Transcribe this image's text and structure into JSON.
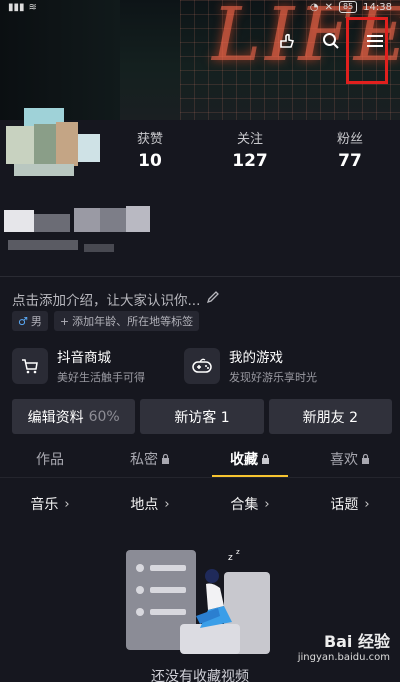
{
  "status": {
    "left_icons": [
      "signal-icon",
      "wifi-icon"
    ],
    "battery": "85",
    "time": "14:38"
  },
  "header": {
    "icons": [
      "gesture-icon",
      "search-icon",
      "menu-icon"
    ],
    "cover_text": "LIFE"
  },
  "stats": [
    {
      "label": "获赞",
      "value": "10"
    },
    {
      "label": "关注",
      "value": "127"
    },
    {
      "label": "粉丝",
      "value": "77"
    }
  ],
  "profile": {
    "intro": "点击添加介绍，让大家认识你...",
    "gender_tag": "男",
    "add_tag": "添加年龄、所在地等标签"
  },
  "shortcuts": [
    {
      "title": "抖音商城",
      "subtitle": "美好生活触手可得"
    },
    {
      "title": "我的游戏",
      "subtitle": "发现好游乐享时光"
    }
  ],
  "buttons": {
    "edit": "编辑资料",
    "edit_pct": "60%",
    "visitors": "新访客 1",
    "friends": "新朋友 2"
  },
  "tabs": [
    {
      "label": "作品",
      "locked": false
    },
    {
      "label": "私密",
      "locked": true
    },
    {
      "label": "收藏",
      "locked": true,
      "active": true
    },
    {
      "label": "喜欢",
      "locked": true
    }
  ],
  "categories": [
    "音乐",
    "地点",
    "合集",
    "话题"
  ],
  "empty_text": "还没有收藏视频",
  "watermark": {
    "brand": "Bai 经验",
    "url": "jingyan.baidu.com"
  },
  "colors": {
    "accent": "#f7c430",
    "highlight": "#e0201e",
    "background": "#16171f"
  }
}
